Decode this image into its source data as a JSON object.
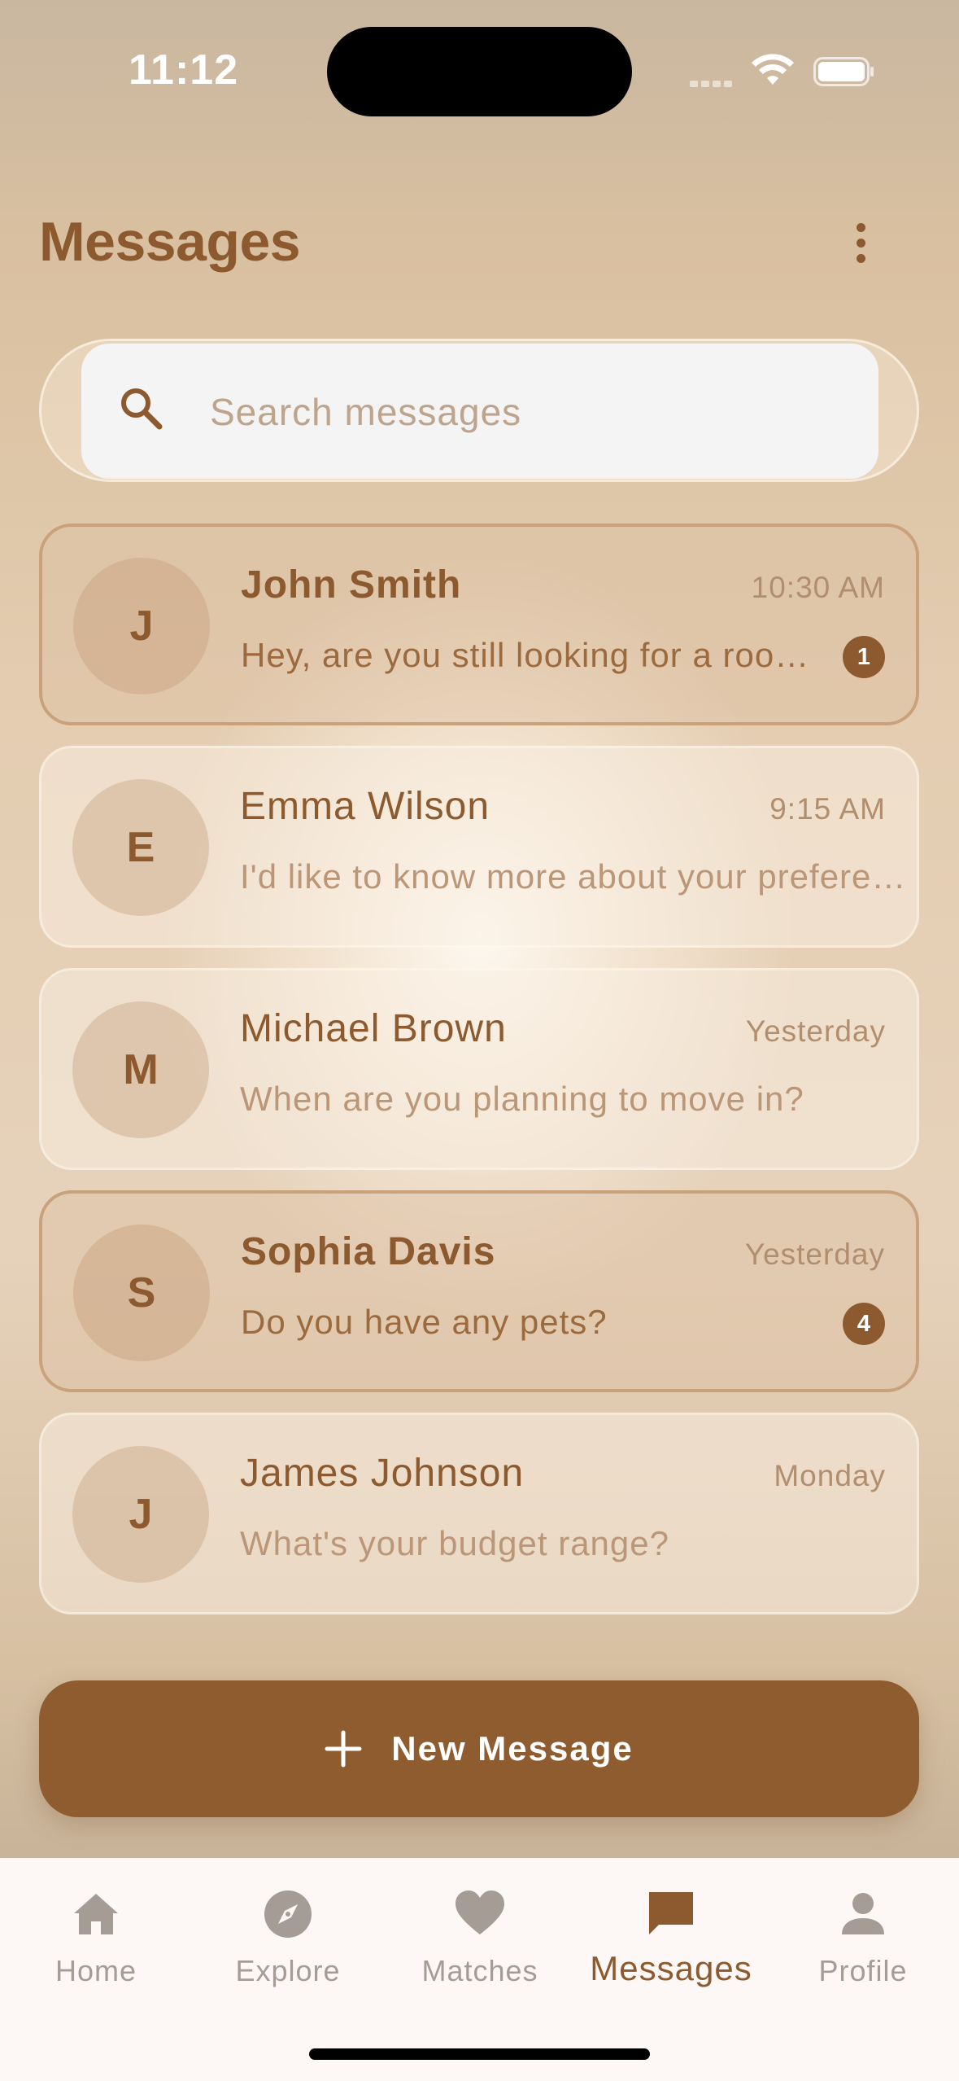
{
  "status_bar": {
    "time": "11:12"
  },
  "header": {
    "title": "Messages"
  },
  "search": {
    "placeholder": "Search messages"
  },
  "conversations": [
    {
      "initial": "J",
      "name": "John Smith",
      "time": "10:30 AM",
      "preview": "Hey, are you still looking for a roommate?",
      "unread": "1"
    },
    {
      "initial": "E",
      "name": "Emma Wilson",
      "time": "9:15 AM",
      "preview": "I'd like to know more about your preferences",
      "unread": null
    },
    {
      "initial": "M",
      "name": "Michael Brown",
      "time": "Yesterday",
      "preview": "When are you planning to move in?",
      "unread": null
    },
    {
      "initial": "S",
      "name": "Sophia Davis",
      "time": "Yesterday",
      "preview": "Do you have any pets?",
      "unread": "4"
    },
    {
      "initial": "J",
      "name": "James Johnson",
      "time": "Monday",
      "preview": "What's your budget range?",
      "unread": null
    }
  ],
  "new_message_button": {
    "label": "New Message",
    "icon": "plus-icon"
  },
  "bottom_nav": {
    "items": [
      {
        "label": "Home",
        "icon": "home-icon"
      },
      {
        "label": "Explore",
        "icon": "compass-icon"
      },
      {
        "label": "Matches",
        "icon": "heart-icon"
      },
      {
        "label": "Messages",
        "icon": "chat-bubble-icon"
      },
      {
        "label": "Profile",
        "icon": "person-icon"
      }
    ],
    "active": "Messages"
  },
  "colors": {
    "accent": "#8c5a2e",
    "button": "#8f5c2f",
    "nav_inactive": "#a59c95",
    "nav_background": "#fdf8f5"
  }
}
